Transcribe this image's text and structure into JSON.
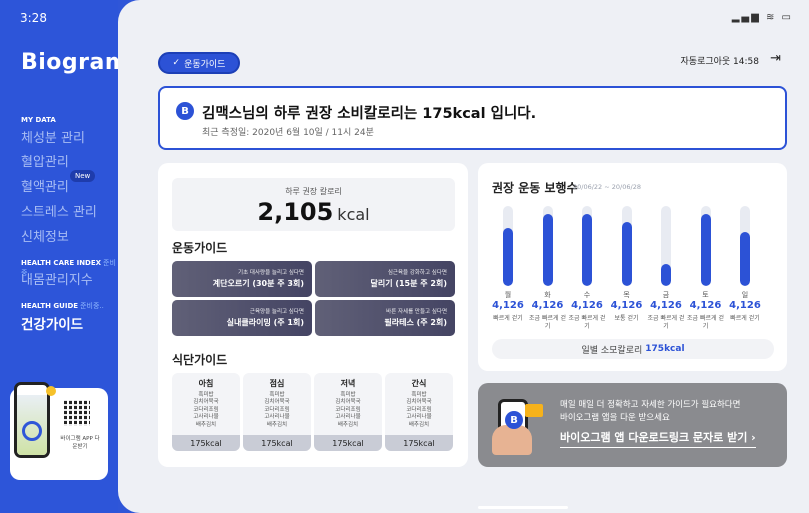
{
  "status_bar": {
    "time": "3:28",
    "icons": "▂▄▆ ≋ ▭"
  },
  "sidebar": {
    "logo": "Biogram",
    "sections": [
      {
        "label": "MY DATA",
        "soon": ""
      },
      {
        "label": "HEALTH CARE INDEX",
        "soon": "준비중.."
      },
      {
        "label": "HEALTH GUIDE",
        "soon": "준비중.."
      }
    ],
    "items": [
      {
        "label": "체성분 관리"
      },
      {
        "label": "혈압관리"
      },
      {
        "label": "혈액관리"
      },
      {
        "label": "스트레스 관리"
      },
      {
        "label": "신체정보"
      },
      {
        "label": "내몸관리지수"
      },
      {
        "label": "건강가이드"
      }
    ],
    "new_badge": "New",
    "promo_caption": "바이그램 APP 다운받기"
  },
  "header": {
    "guide_pill": "운동가이드",
    "auto_logout": "자동로그아웃 14:58"
  },
  "banner": {
    "badge": "B",
    "title": "김맥스님의 하루 권장 소비칼로리는 175kcal 입니다.",
    "subtitle": "최근 측정일: 2020년 6월 10일 / 11시 24분"
  },
  "calorie": {
    "label": "하루 권장 칼로리",
    "value": "2,105",
    "unit": "kcal"
  },
  "exercise": {
    "title": "운동가이드",
    "tiles": [
      {
        "small": "기초 대사량을 늘리고 싶다면",
        "big": "계단오르기 (30분 주 3회)"
      },
      {
        "small": "심근육을 강화하고 싶다면",
        "big": "달리기 (15분 주 2회)"
      },
      {
        "small": "근육양을 늘리고 싶다면",
        "big": "실내클라이밍 (주 1회)"
      },
      {
        "small": "바른 자세를 만들고 싶다면",
        "big": "필라테스 (주 2회)"
      }
    ]
  },
  "diet": {
    "title": "식단가이드",
    "meals": [
      {
        "name": "아침",
        "items": [
          "흑미밥",
          "김치어묵국",
          "코다리조림",
          "고사리나물",
          "배추김치"
        ],
        "kcal": "175kcal"
      },
      {
        "name": "점심",
        "items": [
          "흑미밥",
          "김치어묵국",
          "코다리조림",
          "고사리나물",
          "배추김치"
        ],
        "kcal": "175kcal"
      },
      {
        "name": "저녁",
        "items": [
          "흑미밥",
          "김치어묵국",
          "코다리조림",
          "고사리나물",
          "배추김치"
        ],
        "kcal": "175kcal"
      },
      {
        "name": "간식",
        "items": [
          "흑미밥",
          "김치어묵국",
          "코다리조림",
          "고사리나물",
          "배추김치"
        ],
        "kcal": "175kcal"
      }
    ]
  },
  "steps": {
    "title": "권장 운동 보행수",
    "range": "20/06/22 ~ 20/06/28",
    "total_label": "일별 소모칼로리",
    "total_value": "175kcal"
  },
  "chart_data": {
    "type": "bar",
    "categories": [
      "월",
      "화",
      "수",
      "목",
      "금",
      "토",
      "일"
    ],
    "values": [
      4126,
      4126,
      4126,
      4126,
      4126,
      4126,
      4126
    ],
    "value_labels": [
      "4,126",
      "4,126",
      "4,126",
      "4,126",
      "4,126",
      "4,126",
      "4,126"
    ],
    "levels": [
      "빠르게 걷기",
      "조금 빠르게 걷기",
      "조금 빠르게 걷기",
      "보통 걷기",
      "조금 빠르게 걷기",
      "조금 빠르게 걷기",
      "빠르게 걷기"
    ],
    "fill_fraction": [
      0.73,
      0.9,
      0.9,
      0.8,
      0.28,
      0.9,
      0.68
    ],
    "color": "#2c52d6"
  },
  "promo": {
    "text_line1": "매일 매일 더 정확하고 자세한 가이드가 필요하다면",
    "text_line2": "바이오그램 앱을 다운 받으세요",
    "link": "바이오그램 앱 다운로드링크 문자로 받기 ›"
  }
}
